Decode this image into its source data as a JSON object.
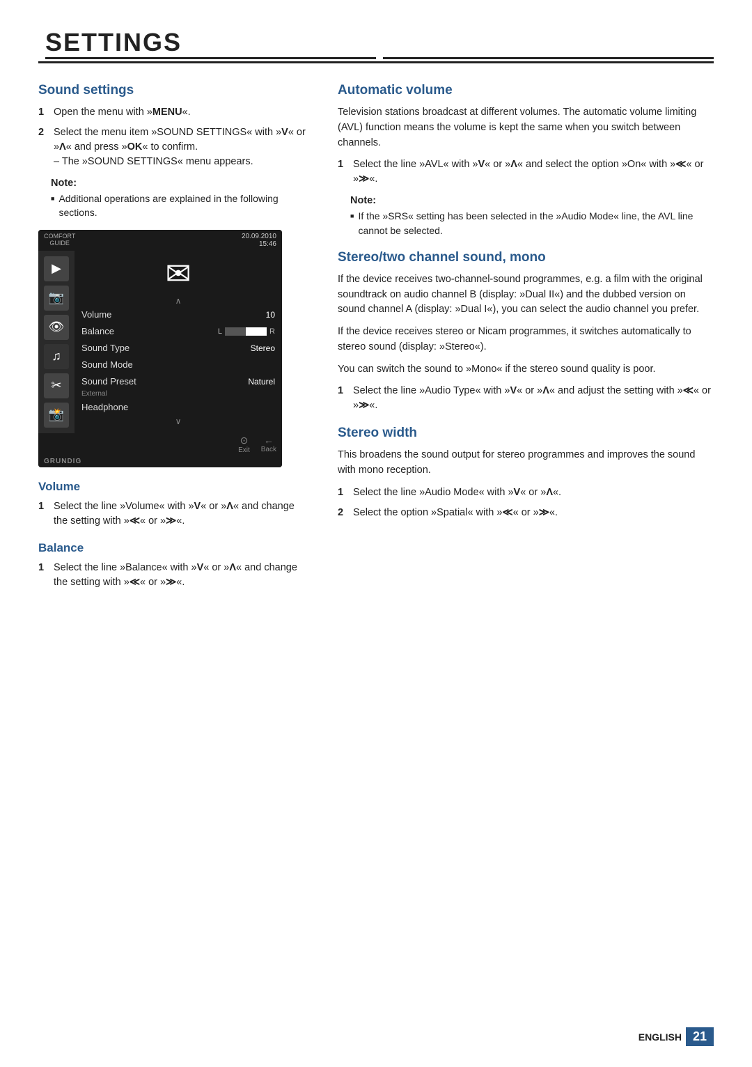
{
  "page": {
    "title": "SETTINGS",
    "footer": {
      "language": "ENGLISH",
      "page_number": "21"
    }
  },
  "left_column": {
    "section_heading": "Sound settings",
    "steps": [
      {
        "num": "1",
        "text": "Open the menu with »MENU«."
      },
      {
        "num": "2",
        "text": "Select the menu item »SOUND SETTINGS« with »V« or »Λ« and press »OK« to confirm.",
        "sub": "– The »SOUND SETTINGS« menu appears."
      }
    ],
    "note_label": "Note:",
    "note_text": "Additional operations are explained in the following sections.",
    "tv_menu": {
      "top_label": "COMFORT\nGUIDE",
      "date": "20.09.2010\n15:46",
      "big_icon": "🎵",
      "arrow_up": "∧",
      "arrow_down": "∨",
      "rows": [
        {
          "label": "Volume",
          "value": "10",
          "selected": false
        },
        {
          "label": "Balance",
          "value": "",
          "balance": true,
          "selected": false
        },
        {
          "label": "Sound Type",
          "value": "Stereo",
          "selected": false
        },
        {
          "label": "Sound Mode",
          "value": "",
          "selected": false
        },
        {
          "label": "Sound Preset",
          "value": "Naturel",
          "selected": false
        },
        {
          "label": "External",
          "sub": true
        },
        {
          "label": "Headphone",
          "value": "",
          "selected": false
        }
      ],
      "bottom_buttons": [
        {
          "icon": "⊙",
          "label": "Exit"
        },
        {
          "icon": "←",
          "label": "Back"
        }
      ],
      "brand": "GRUNDIG"
    },
    "volume_heading": "Volume",
    "volume_step": {
      "num": "1",
      "text": "Select the line »Volume« with »V« or »Λ« and change the setting with »≪« or »≫«."
    },
    "balance_heading": "Balance",
    "balance_step": {
      "num": "1",
      "text": "Select the line »Balance« with »V« or »Λ« and change the setting with »≪« or »≫«."
    }
  },
  "right_column": {
    "auto_volume": {
      "heading": "Automatic volume",
      "para1": "Television stations broadcast at different volumes. The automatic volume limiting (AVL) function means the volume is kept the same when you switch between channels.",
      "step": {
        "num": "1",
        "text": "Select the line »AVL« with »V« or »Λ« and select the option »On« with »≪« or »≫«."
      },
      "note_label": "Note:",
      "note_text": "If the »SRS« setting has been selected in the »Audio Mode« line, the AVL line cannot be selected."
    },
    "stereo_mono": {
      "heading": "Stereo/two channel sound, mono",
      "para1": "If the device receives two-channel-sound programmes, e.g. a film with the original soundtrack on audio channel B (display: »Dual II«) and the dubbed version on sound channel A (display: »Dual I«), you can select the audio channel you prefer.",
      "para2": "If the device receives stereo or Nicam programmes, it switches automatically to stereo sound (display: »Stereo«).",
      "para3": "You can switch the sound to »Mono« if the stereo sound quality is poor.",
      "step": {
        "num": "1",
        "text": "Select the line »Audio Type« with »V« or »Λ« and adjust the setting with »≪« or »≫«."
      }
    },
    "stereo_width": {
      "heading": "Stereo width",
      "para1": "This broadens the sound output for stereo programmes and improves the sound with mono reception.",
      "steps": [
        {
          "num": "1",
          "text": "Select the line »Audio Mode« with »V« or »Λ«."
        },
        {
          "num": "2",
          "text": "Select the option »Spatial« with »≪« or »≫«."
        }
      ]
    }
  }
}
